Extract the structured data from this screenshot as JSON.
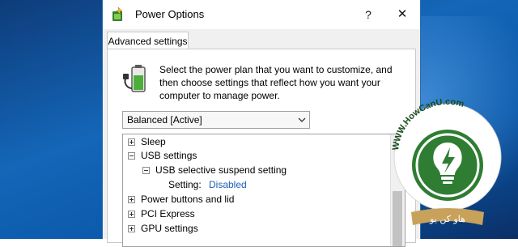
{
  "window": {
    "title": "Power Options",
    "help_label": "?",
    "close_label": "✕"
  },
  "tabs": [
    {
      "label": "Advanced settings"
    }
  ],
  "description": "Select the power plan that you want to customize, and then choose settings that reflect how you want your computer to manage power.",
  "plan_select": {
    "selected": "Balanced [Active]"
  },
  "tree": {
    "items": [
      {
        "label": "Sleep"
      },
      {
        "label": "USB settings"
      },
      {
        "label": "USB selective suspend setting"
      },
      {
        "label": "Setting:",
        "value": "Disabled"
      },
      {
        "label": "Power buttons and lid"
      },
      {
        "label": "PCI Express"
      },
      {
        "label": "GPU settings"
      }
    ]
  },
  "watermark": {
    "site": "WWW.HowCanU.com",
    "brand": "هاو کن یو"
  },
  "colors": {
    "accent": "#1a5fb4",
    "desktop": "#1466b8",
    "watermark_green": "#2e7d32"
  }
}
